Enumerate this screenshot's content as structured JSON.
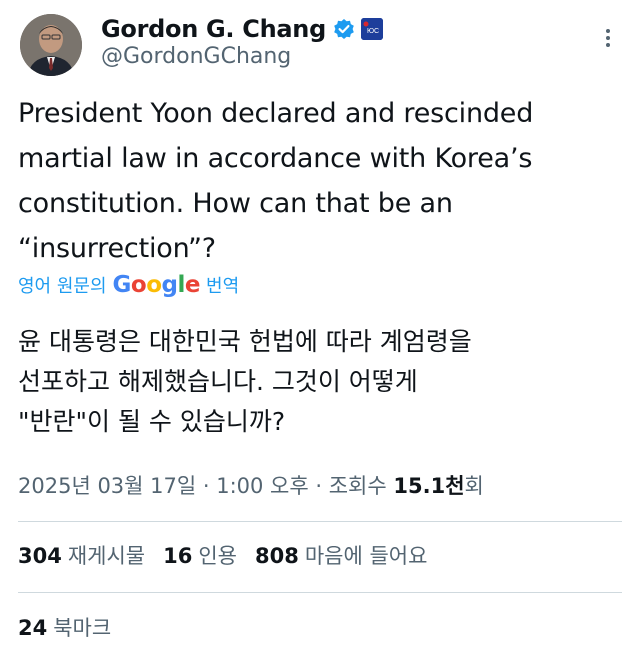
{
  "author": {
    "display_name": "Gordon G. Chang",
    "handle": "@GordonGChang",
    "affiliation_badge_text": "ЮС"
  },
  "tweet": {
    "text": "President Yoon declared and rescinded\nmartial law in accordance with Korea’s\nconstitution. How can that be an\n“insurrection”?",
    "translate_prefix": "영어 원문의",
    "translate_brand": "Google",
    "translate_suffix": "번역",
    "translated_text": "윤 대통령은 대한민국 헌법에 따라 계엄령을\n선포하고 해제했습니다. 그것이 어떻게\n\"반란\"이 될 수 있습니까?",
    "timestamp": "2025년 03월 17일 · 1:00 오후 · 조회수",
    "views_value": "15.1천",
    "views_suffix": "회"
  },
  "stats": {
    "reposts_value": "304",
    "reposts_label": "재게시물",
    "quotes_value": "16",
    "quotes_label": "인용",
    "likes_value": "808",
    "likes_label": "마음에 들어요",
    "bookmarks_value": "24",
    "bookmarks_label": "북마크"
  },
  "icons": {
    "verified": "verified-badge-icon",
    "more": "more-options-icon"
  },
  "colors": {
    "accent": "#1d9bf0",
    "text": "#0f1419",
    "secondary": "#536471",
    "divider": "#cfd9de",
    "affiliation_bg": "#1d3e9b"
  }
}
